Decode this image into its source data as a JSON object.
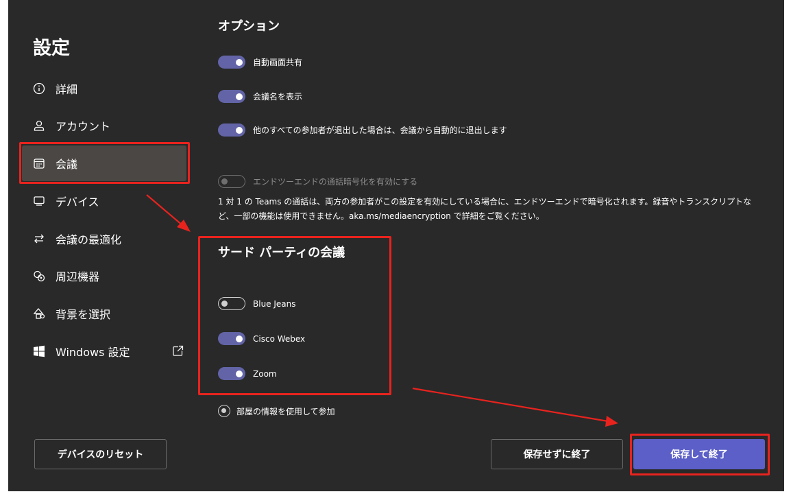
{
  "sidebar": {
    "title": "設定",
    "items": [
      {
        "label": "詳細",
        "icon": "info-icon"
      },
      {
        "label": "アカウント",
        "icon": "person-icon"
      },
      {
        "label": "会議",
        "icon": "calendar-icon",
        "active": true
      },
      {
        "label": "デバイス",
        "icon": "monitor-icon"
      },
      {
        "label": "会議の最適化",
        "icon": "swap-arrows-icon"
      },
      {
        "label": "周辺機器",
        "icon": "peripherals-icon"
      },
      {
        "label": "背景を選択",
        "icon": "shapes-icon"
      },
      {
        "label": "Windows 設定",
        "icon": "windows-logo-icon",
        "external": true
      }
    ],
    "reset_label": "デバイスのリセット"
  },
  "options": {
    "title": "オプション",
    "toggles": [
      {
        "label": "自動画面共有",
        "on": true
      },
      {
        "label": "会議名を表示",
        "on": true
      },
      {
        "label": "他のすべての参加者が退出した場合は、会議から自動的に退出します",
        "on": true
      }
    ],
    "e2e": {
      "label": "エンドツーエンドの通話暗号化を有効にする",
      "on": false,
      "disabled": true,
      "description": "1 対 1 の Teams の通話は、両方の参加者がこの設定を有効にしている場合に、エンドツーエンドで暗号化されます。録音やトランスクリプトなど、一部の機能は使用できません。aka.ms/mediaencryption で詳細をご覧ください。"
    }
  },
  "third_party": {
    "title": "サード パーティの会議",
    "toggles": [
      {
        "label": "Blue Jeans",
        "on": false
      },
      {
        "label": "Cisco Webex",
        "on": true
      },
      {
        "label": "Zoom",
        "on": true
      }
    ]
  },
  "room": {
    "label": "部屋の情報を使用して参加",
    "selected": true
  },
  "footer": {
    "cancel_label": "保存せずに終了",
    "save_label": "保存して終了"
  },
  "colors": {
    "background": "#292929",
    "accent": "#6264a7",
    "primary_button": "#5b5fc7",
    "annotation": "#e8231e"
  }
}
